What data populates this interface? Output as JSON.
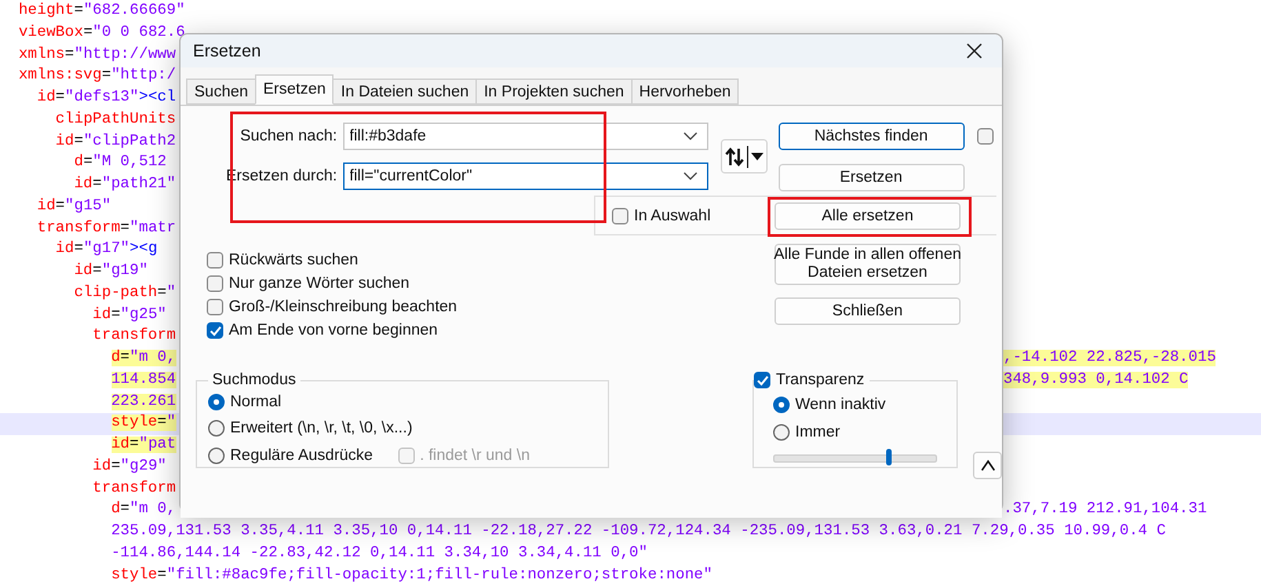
{
  "editor": {
    "lines": [
      {
        "text": "  height=\"682.66669\"",
        "marked": false,
        "current": false
      },
      {
        "text": "  viewBox=\"0 0 682.6",
        "marked": false,
        "current": false
      },
      {
        "text": "  xmlns=\"http://www",
        "marked": false,
        "current": false
      },
      {
        "text": "  xmlns:svg=\"http:/",
        "marked": false,
        "current": false
      },
      {
        "text": "    id=\"defs13\"><cl",
        "marked": false,
        "current": false
      },
      {
        "text": "      clipPathUnits",
        "marked": false,
        "current": false
      },
      {
        "text": "      id=\"clipPath2",
        "marked": false,
        "current": false
      },
      {
        "text": "        d=\"M 0,512",
        "marked": false,
        "current": false
      },
      {
        "text": "        id=\"path21\"",
        "marked": false,
        "current": false
      },
      {
        "text": "    id=\"g15\"",
        "marked": false,
        "current": false
      },
      {
        "text": "    transform=\"matr",
        "marked": false,
        "current": false
      },
      {
        "text": "      id=\"g17\"><g",
        "marked": false,
        "current": false
      },
      {
        "text": "        id=\"g19\"",
        "marked": false,
        "current": false
      },
      {
        "text": "        clip-path=\"",
        "marked": false,
        "current": false
      },
      {
        "text": "          id=\"g25\"",
        "marked": false,
        "current": false
      },
      {
        "text": "          transform",
        "marked": false,
        "current": false
      },
      {
        "text": "            d=\"m 0,",
        "right_text": ",-14.102 22.825,-28.015",
        "marked": true,
        "current": false
      },
      {
        "text": "            114.854",
        "right_text": "348,9.993 0,14.102 C",
        "marked": true,
        "current": false
      },
      {
        "text": "            223.261",
        "marked": true,
        "current": false
      },
      {
        "text": "            style=\"",
        "marked": true,
        "current": true
      },
      {
        "text": "            id=\"pat",
        "marked": true,
        "current": false
      },
      {
        "text": "          id=\"g29\"",
        "marked": false,
        "current": false
      },
      {
        "text": "          transform",
        "marked": false,
        "current": false
      },
      {
        "text": "            d=\"m 0,",
        "right_text": ".37,7.19 212.91,104.31",
        "marked": false,
        "current": false
      },
      {
        "text": "            235.09,131.53 3.35,4.11 3.35,10 0,14.11 -22.18,27.22 -109.72,124.34 -235.09,131.53 3.63,0.21 7.29,0.35 10.99,0.4 C",
        "marked": false,
        "current": false
      },
      {
        "text": "            -114.86,144.14 -22.83,42.12 0,14.11 3.34,10 3.34,4.11 0,0\"",
        "marked": false,
        "current": false
      },
      {
        "text": "            style=\"fill:#8ac9fe;fill-opacity:1;fill-rule:nonzero;stroke:none\"",
        "marked": false,
        "current": false
      }
    ]
  },
  "dialog": {
    "title": "Ersetzen",
    "tabs": [
      {
        "label": "Suchen",
        "selected": false
      },
      {
        "label": "Ersetzen",
        "selected": true
      },
      {
        "label": "In Dateien suchen",
        "selected": false
      },
      {
        "label": "In Projekten suchen",
        "selected": false
      },
      {
        "label": "Hervorheben",
        "selected": false
      }
    ],
    "fields": [
      {
        "label": "Suchen nach:",
        "value": "fill:#b3dafe",
        "focused": false
      },
      {
        "label": "Ersetzen durch:",
        "value": "fill=\"currentColor\"",
        "focused": true
      }
    ],
    "find_next_button": {
      "label": "Nächstes finden",
      "default": true
    },
    "side_checkbox": {
      "checked": false
    },
    "replace_button": {
      "label": "Ersetzen",
      "default": false
    },
    "in_selection": {
      "label": "In Auswahl",
      "checked": false
    },
    "replace_all_button": {
      "label": "Alle ersetzen",
      "default": false
    },
    "replace_all_open_button": {
      "lines": [
        "Alle Funde in allen offenen",
        "Dateien ersetzen"
      ],
      "default": false
    },
    "close_button": {
      "label": "Schließen",
      "default": false
    },
    "options": [
      {
        "label": "Rückwärts suchen",
        "checked": false
      },
      {
        "label": "Nur ganze Wörter suchen",
        "checked": false
      },
      {
        "label": "Groß-/Kleinschreibung beachten",
        "checked": false
      },
      {
        "label": "Am Ende von vorne beginnen",
        "checked": true
      }
    ],
    "search_mode": {
      "title": "Suchmodus",
      "options": [
        {
          "label": "Normal",
          "selected": true
        },
        {
          "label": "Erweitert (\\n, \\r, \\t, \\0, \\x...)",
          "selected": false
        },
        {
          "label": "Reguläre Ausdrücke",
          "selected": false
        }
      ],
      "dot_newline": {
        "label": ". findet \\r und \\n",
        "checked": false,
        "disabled": true
      }
    },
    "transparency": {
      "label": "Transparenz",
      "checked": true,
      "options": [
        {
          "label": "Wenn inaktiv",
          "selected": true
        },
        {
          "label": "Immer",
          "selected": false
        }
      ],
      "level": 0.71
    }
  }
}
